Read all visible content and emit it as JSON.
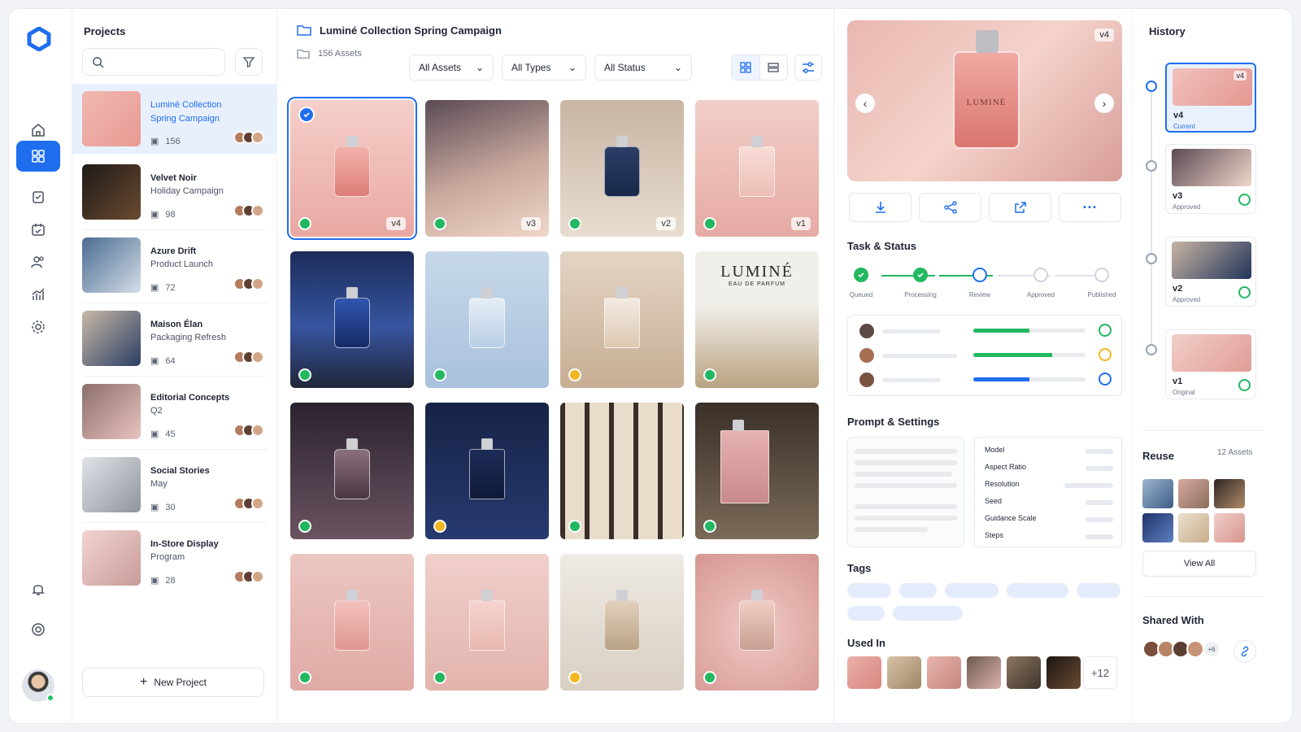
{
  "projects_panel": {
    "title": "Projects",
    "search_placeholder": "",
    "new_project_label": "New Project",
    "items": [
      {
        "name": "Luminé Collection Spring Campaign",
        "sub": "",
        "count": "156",
        "active": true
      },
      {
        "name": "Velvet Noir",
        "sub": "Holiday Campaign",
        "count": "98"
      },
      {
        "name": "Azure Drift",
        "sub": "Product Launch",
        "count": "72"
      },
      {
        "name": "Maison Élan",
        "sub": "Packaging Refresh",
        "count": "64"
      },
      {
        "name": "Editorial Concepts",
        "sub": "Q2",
        "count": "45"
      },
      {
        "name": "Social Stories",
        "sub": "May",
        "count": "30"
      },
      {
        "name": "In-Store Display",
        "sub": "Program",
        "count": "28"
      }
    ]
  },
  "main": {
    "title": "Luminé Collection Spring Campaign",
    "asset_count": "156 Assets",
    "filters": [
      "All Assets",
      "All Types",
      "All Status"
    ],
    "cards": [
      {
        "status": "ok",
        "version": "v4",
        "selected": true
      },
      {
        "status": "ok",
        "version": "v3"
      },
      {
        "status": "ok",
        "version": "v2"
      },
      {
        "status": "ok",
        "version": "v1"
      },
      {
        "status": "ok"
      },
      {
        "status": "ok"
      },
      {
        "status": "pend"
      },
      {
        "status": "ok",
        "text": "LUMINÉ",
        "subtext": "EAU DE PARFUM"
      },
      {
        "status": "ok"
      },
      {
        "status": "pend"
      },
      {
        "status": "ok"
      },
      {
        "status": "ok"
      },
      {
        "status": "ok"
      },
      {
        "status": "ok"
      },
      {
        "status": "pend"
      },
      {
        "status": "ok"
      }
    ]
  },
  "detail": {
    "preview_version": "v4",
    "preview_label": "LUMINÉ",
    "task_title": "Task & Status",
    "steps": [
      "Queued",
      "Processing",
      "Review",
      "Approved",
      "Published"
    ],
    "progress": [
      0.5,
      0.7,
      0.5
    ],
    "prompt_title": "Prompt & Settings",
    "settings": [
      "Model",
      "Aspect Ratio",
      "Resolution",
      "Seed",
      "Guidance Scale",
      "Steps"
    ],
    "tags_title": "Tags",
    "used_title": "Used In",
    "used_more": "+12"
  },
  "history": {
    "title": "History",
    "versions": [
      {
        "v": "v4",
        "status": "Current"
      },
      {
        "v": "v3",
        "status": "Approved"
      },
      {
        "v": "v2",
        "status": "Approved"
      },
      {
        "v": "v1",
        "status": "Original"
      }
    ],
    "reuse_title": "Reuse",
    "reuse_count": "12 Assets",
    "view_all": "View All",
    "shared_title": "Shared With",
    "shared_more": "+6"
  },
  "colors": {
    "accent": "#1f6ef0",
    "success": "#22b861",
    "pending": "#f3b723"
  }
}
